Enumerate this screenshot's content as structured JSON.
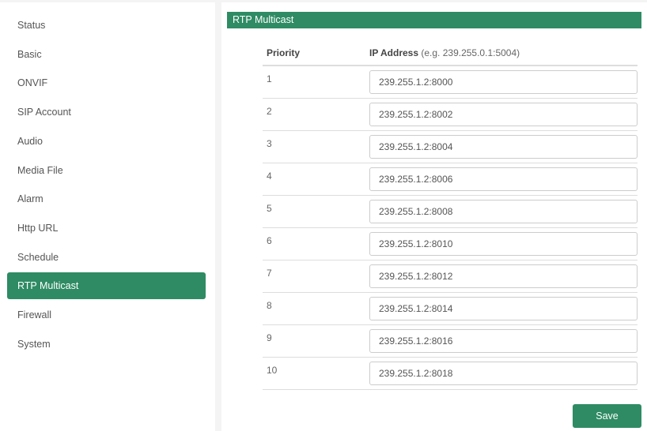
{
  "sidebar": {
    "items": [
      {
        "label": "Status"
      },
      {
        "label": "Basic"
      },
      {
        "label": "ONVIF"
      },
      {
        "label": "SIP Account"
      },
      {
        "label": "Audio"
      },
      {
        "label": "Media File"
      },
      {
        "label": "Alarm"
      },
      {
        "label": "Http URL"
      },
      {
        "label": "Schedule"
      },
      {
        "label": "RTP Multicast",
        "active": true
      },
      {
        "label": "Firewall"
      },
      {
        "label": "System"
      }
    ]
  },
  "main": {
    "title": "RTP Multicast",
    "columns": {
      "priority": "Priority",
      "ip": "IP Address",
      "ip_hint": "(e.g. 239.255.0.1:5004)"
    },
    "rows": [
      {
        "priority": "1",
        "ip": "239.255.1.2:8000"
      },
      {
        "priority": "2",
        "ip": "239.255.1.2:8002"
      },
      {
        "priority": "3",
        "ip": "239.255.1.2:8004"
      },
      {
        "priority": "4",
        "ip": "239.255.1.2:8006"
      },
      {
        "priority": "5",
        "ip": "239.255.1.2:8008"
      },
      {
        "priority": "6",
        "ip": "239.255.1.2:8010"
      },
      {
        "priority": "7",
        "ip": "239.255.1.2:8012"
      },
      {
        "priority": "8",
        "ip": "239.255.1.2:8014"
      },
      {
        "priority": "9",
        "ip": "239.255.1.2:8016"
      },
      {
        "priority": "10",
        "ip": "239.255.1.2:8018"
      }
    ],
    "save_label": "Save"
  },
  "colors": {
    "accent": "#2e8b63"
  }
}
